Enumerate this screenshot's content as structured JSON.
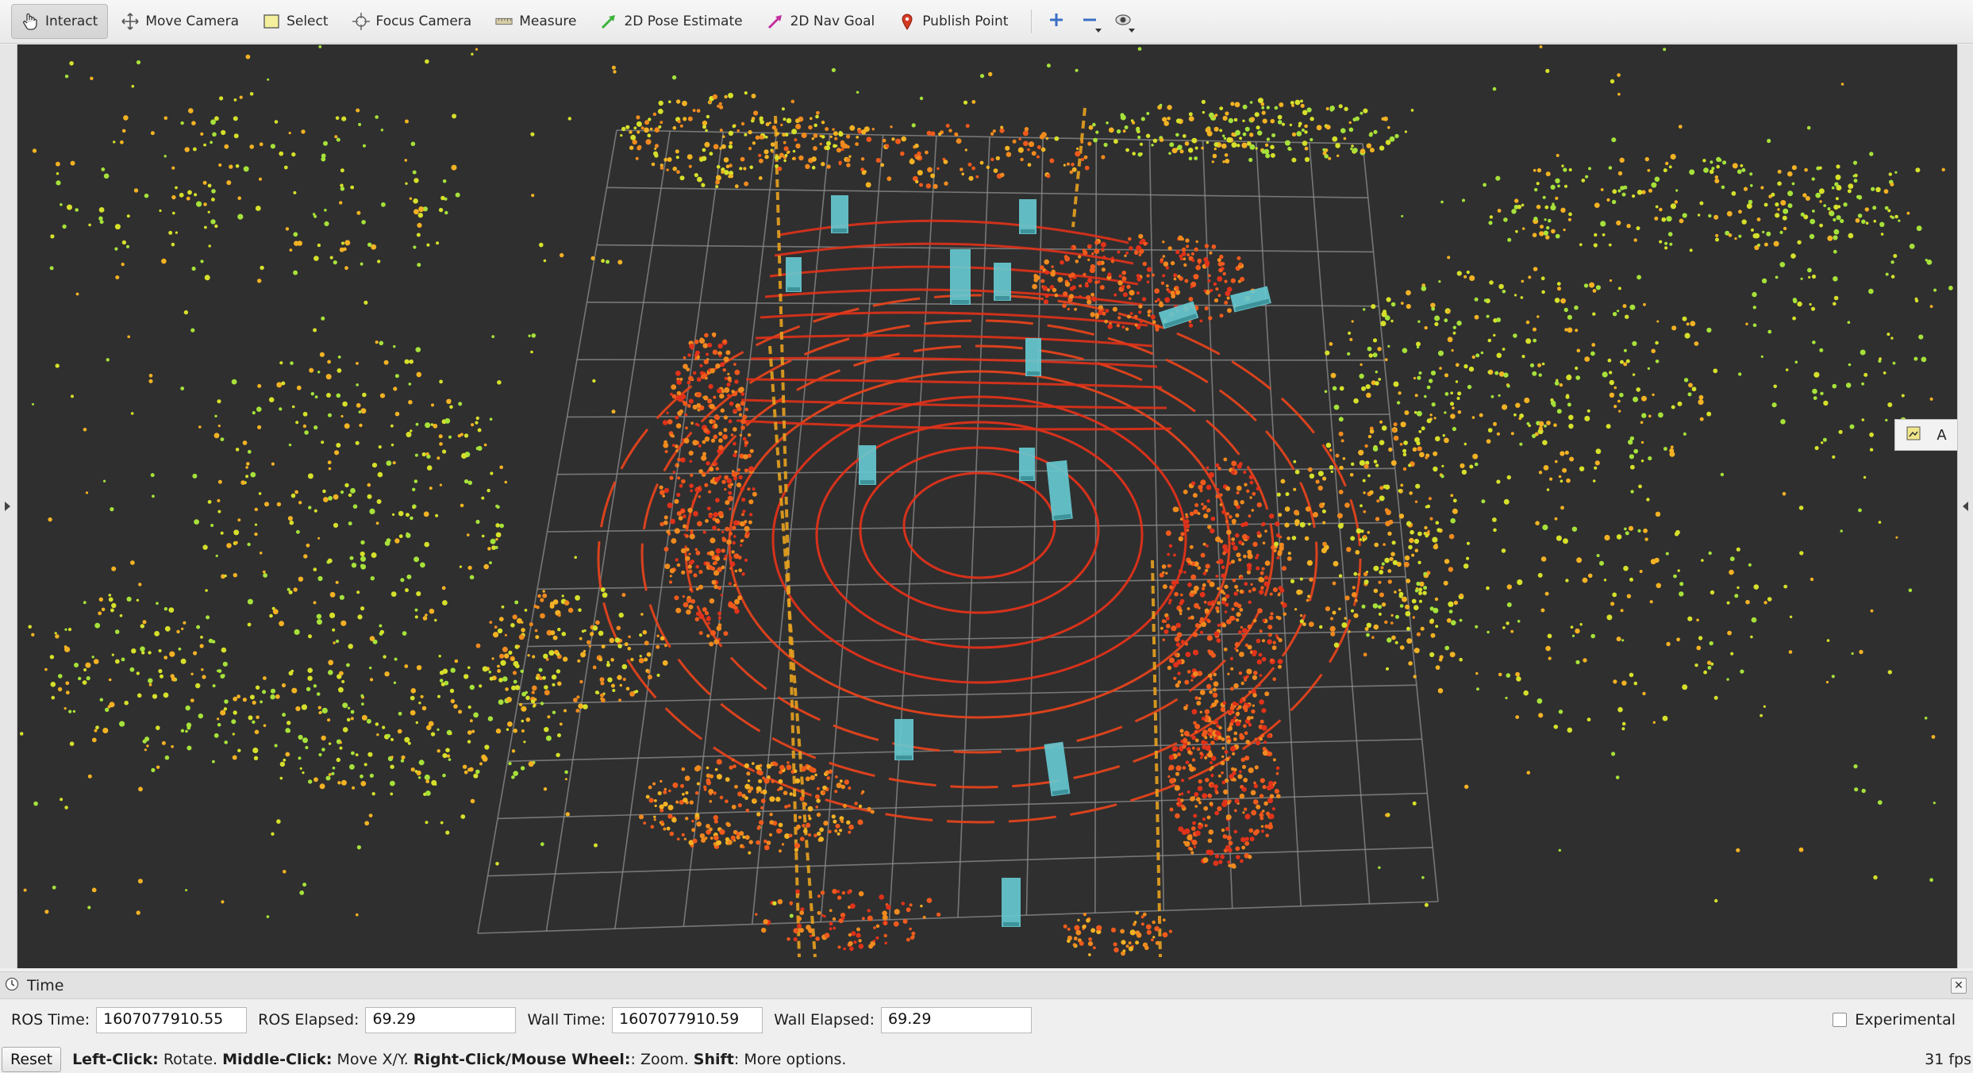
{
  "toolbar": {
    "tools": [
      {
        "label": "Interact",
        "icon": "hand-pointer-icon",
        "active": true
      },
      {
        "label": "Move Camera",
        "icon": "move-arrows-icon"
      },
      {
        "label": "Select",
        "icon": "select-rectangle-icon"
      },
      {
        "label": "Focus Camera",
        "icon": "focus-crosshair-icon"
      },
      {
        "label": "Measure",
        "icon": "ruler-icon"
      },
      {
        "label": "2D Pose Estimate",
        "icon": "green-arrow-icon"
      },
      {
        "label": "2D Nav Goal",
        "icon": "magenta-arrow-icon"
      },
      {
        "label": "Publish Point",
        "icon": "map-pin-icon"
      }
    ],
    "extra_icons": [
      "add-tool-icon",
      "remove-tool-icon",
      "view-options-icon"
    ]
  },
  "viewport": {
    "background": "#2f2f2f",
    "grid_color": "#8a8a8a",
    "bbox_color": "#66c8d0",
    "point_colors": [
      "#e0321a",
      "#ef5a1c",
      "#f08a1e",
      "#f3b223",
      "#d6e02a",
      "#a6e23a"
    ]
  },
  "float_panel": {
    "icons": [
      "image-icon",
      "text-icon",
      "tools-icon"
    ],
    "text_label": "A"
  },
  "time_panel": {
    "title": "Time",
    "ros_time_label": "ROS Time:",
    "ros_time_value": "1607077910.55",
    "ros_elapsed_label": "ROS Elapsed:",
    "ros_elapsed_value": "69.29",
    "wall_time_label": "Wall Time:",
    "wall_time_value": "1607077910.59",
    "wall_elapsed_label": "Wall Elapsed:",
    "wall_elapsed_value": "69.29",
    "experimental_label": "Experimental",
    "experimental_checked": false
  },
  "status_bar": {
    "reset_label": "Reset",
    "hint_parts": [
      {
        "bold": "Left-Click:",
        "text": " Rotate. "
      },
      {
        "bold": "Middle-Click:",
        "text": " Move X/Y. "
      },
      {
        "bold": "Right-Click/Mouse Wheel:",
        "text": ": Zoom. "
      },
      {
        "bold": "Shift",
        "text": ": More options."
      }
    ],
    "fps": "31 fps"
  }
}
